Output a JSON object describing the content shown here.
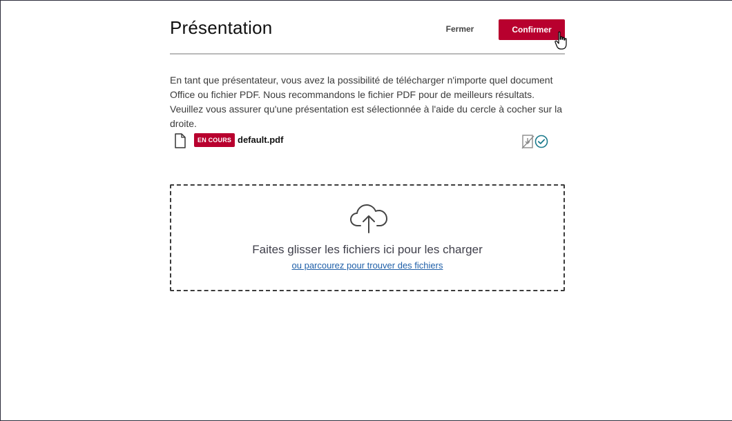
{
  "modal": {
    "title": "Présentation",
    "close_label": "Fermer",
    "confirm_label": "Confirmer",
    "description": "En tant que présentateur, vous avez la possibilité de télécharger n'importe quel document Office ou fichier PDF. Nous recommandons le fichier PDF pour de meilleurs résultats. Veuillez vous assurer qu'une présentation est sélectionnée à l'aide du cercle à cocher sur la droite."
  },
  "files": [
    {
      "icon": "file-icon",
      "badge": "EN COURS",
      "name": "default.pdf",
      "actions": [
        "download-disabled-icon",
        "check-circle-icon"
      ]
    }
  ],
  "dropzone": {
    "icon": "cloud-upload-icon",
    "text": "Faites glisser les fichiers ici pour les charger",
    "link": "ou parcourez pour trouver des fichiers"
  },
  "colors": {
    "accent": "#b8002e",
    "link": "#1f5fa8",
    "check": "#1a7a8c"
  }
}
